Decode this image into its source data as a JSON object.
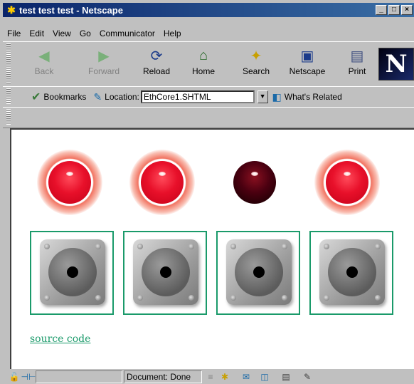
{
  "window": {
    "title": "test test test - Netscape"
  },
  "titlebar_buttons": {
    "minimize": "_",
    "maximize": "□",
    "close": "×"
  },
  "menu": [
    "File",
    "Edit",
    "View",
    "Go",
    "Communicator",
    "Help"
  ],
  "navigation": [
    {
      "label": "Back",
      "icon": "back-arrow-icon",
      "glyph": "◀",
      "enabled": false
    },
    {
      "label": "Forward",
      "icon": "forward-arrow-icon",
      "glyph": "▶",
      "enabled": false
    },
    {
      "label": "Reload",
      "icon": "reload-icon",
      "glyph": "⟳",
      "enabled": true
    },
    {
      "label": "Home",
      "icon": "home-icon",
      "glyph": "⌂",
      "enabled": true
    },
    {
      "label": "Search",
      "icon": "search-icon",
      "glyph": "✦",
      "enabled": true
    },
    {
      "label": "Netscape",
      "icon": "my-netscape-icon",
      "glyph": "▣",
      "enabled": true
    },
    {
      "label": "Print",
      "icon": "print-icon",
      "glyph": "▤",
      "enabled": true
    }
  ],
  "brand_logo": "N",
  "location": {
    "bookmarks_label": "Bookmarks",
    "location_label": "Location:",
    "url": "EthCore1.SHTML",
    "related_label": "What's Related"
  },
  "leds": [
    {
      "state": "on"
    },
    {
      "state": "on"
    },
    {
      "state": "off"
    },
    {
      "state": "on"
    }
  ],
  "buttons": [
    {
      "id": 1
    },
    {
      "id": 2
    },
    {
      "id": 3
    },
    {
      "id": 4
    }
  ],
  "source_link": "source code",
  "status": {
    "text": "Document: Done"
  },
  "colors": {
    "link": "#1a9a6a",
    "box_border": "#1a9a6a",
    "led_on": "#e8102a",
    "led_off": "#1a0004"
  }
}
